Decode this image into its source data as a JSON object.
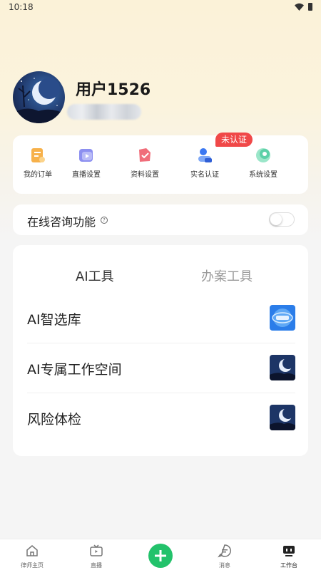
{
  "status_bar": {
    "time": "10:18"
  },
  "profile": {
    "username": "用户1526"
  },
  "quick_actions": [
    {
      "label": "我的订单",
      "icon": "order-icon"
    },
    {
      "label": "直播设置",
      "icon": "live-settings-icon"
    },
    {
      "label": "资料设置",
      "icon": "profile-settings-icon"
    },
    {
      "label": "实名认证",
      "icon": "id-verify-icon"
    },
    {
      "label": "系统设置",
      "icon": "system-settings-icon"
    }
  ],
  "verify_badge": "未认证",
  "consult": {
    "label": "在线咨询功能",
    "enabled": false
  },
  "tools": {
    "tabs": [
      "AI工具",
      "办案工具"
    ],
    "active_tab": 0,
    "items": [
      {
        "label": "AI智选库"
      },
      {
        "label": "AI专属工作空间"
      },
      {
        "label": "风险体检"
      }
    ]
  },
  "bottom_nav": [
    {
      "label": "律师主页",
      "icon": "home-icon"
    },
    {
      "label": "直播",
      "icon": "tv-icon"
    },
    {
      "label": "",
      "icon": "add-icon"
    },
    {
      "label": "消息",
      "icon": "message-icon"
    },
    {
      "label": "工作台",
      "icon": "workbench-icon",
      "active": true
    }
  ],
  "colors": {
    "accent_green": "#23c26b",
    "badge_red": "#f04848"
  }
}
